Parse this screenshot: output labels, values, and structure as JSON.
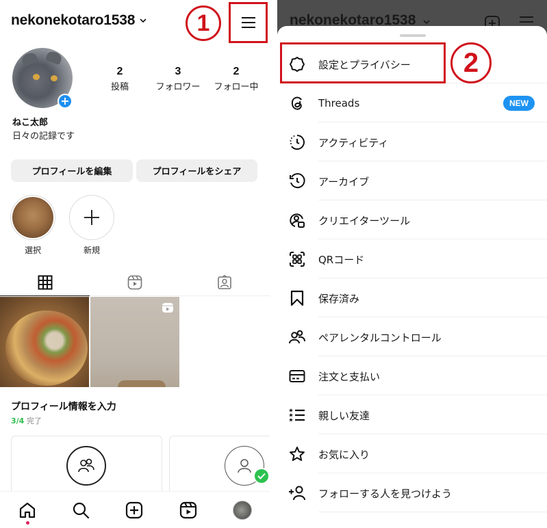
{
  "left": {
    "header": {
      "username": "nekonekotaro1538",
      "step_marker": "1"
    },
    "profile": {
      "stats": [
        {
          "value": "2",
          "label": "投稿"
        },
        {
          "value": "3",
          "label": "フォロワー"
        },
        {
          "value": "2",
          "label": "フォロー中"
        }
      ],
      "display_name": "ねこ太郎",
      "bio": "日々の記録です"
    },
    "buttons": {
      "edit": "プロフィールを編集",
      "share": "プロフィールをシェア"
    },
    "highlights": [
      {
        "label": "選択"
      },
      {
        "label": "新規"
      }
    ],
    "profile_info": {
      "title": "プロフィール情報を入力",
      "progress_done": "3/4",
      "progress_label": "完了"
    }
  },
  "right": {
    "header": {
      "username": "nekonekotaro1538"
    },
    "step_marker": "2",
    "menu": [
      {
        "label": "設定とプライバシー",
        "icon": "gear-icon"
      },
      {
        "label": "Threads",
        "icon": "threads-icon",
        "badge": "NEW"
      },
      {
        "label": "アクティビティ",
        "icon": "activity-icon"
      },
      {
        "label": "アーカイブ",
        "icon": "archive-icon"
      },
      {
        "label": "クリエイターツール",
        "icon": "creator-tools-icon"
      },
      {
        "label": "QRコード",
        "icon": "qr-code-icon"
      },
      {
        "label": "保存済み",
        "icon": "bookmark-icon"
      },
      {
        "label": "ペアレンタルコントロール",
        "icon": "parental-control-icon"
      },
      {
        "label": "注文と支払い",
        "icon": "card-icon"
      },
      {
        "label": "親しい友達",
        "icon": "close-friends-icon"
      },
      {
        "label": "お気に入り",
        "icon": "star-icon"
      },
      {
        "label": "フォローする人を見つけよう",
        "icon": "add-person-icon"
      }
    ]
  },
  "colors": {
    "annotation_red": "#d0121b",
    "accent_blue": "#1e93f2",
    "success_green": "#2dc24f",
    "notification_dot": "#e0245e"
  }
}
